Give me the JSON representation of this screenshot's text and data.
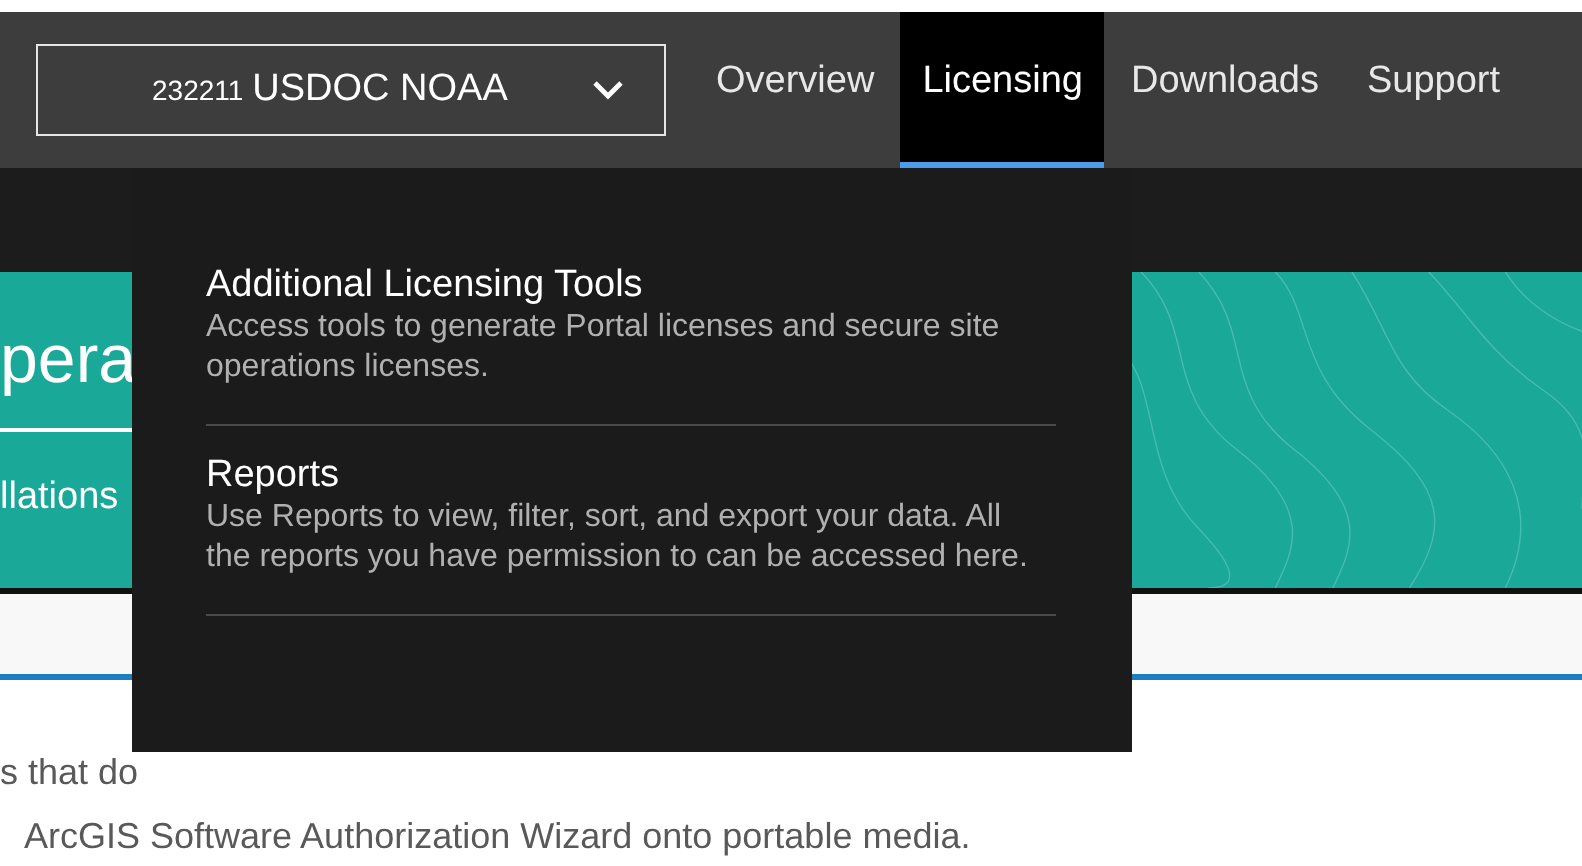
{
  "account_select": {
    "number": "232211",
    "name": "USDOC NOAA"
  },
  "nav_tabs": [
    {
      "label": "Overview",
      "selected": false
    },
    {
      "label": "Licensing",
      "selected": true
    },
    {
      "label": "Downloads",
      "selected": false
    },
    {
      "label": "Support",
      "selected": false
    }
  ],
  "hero": {
    "title": "pera",
    "tab": "llations"
  },
  "body_lines": [
    "s that do",
    "ArcGIS Software Authorization Wizard onto portable media."
  ],
  "menu": {
    "items": [
      {
        "title": "Additional Licensing Tools",
        "description": "Access tools to generate Portal licenses and secure site operations licenses."
      },
      {
        "title": "Reports",
        "description": "Use Reports to view, filter, sort, and export your data. All the reports you have permission to can be accessed here."
      }
    ]
  }
}
